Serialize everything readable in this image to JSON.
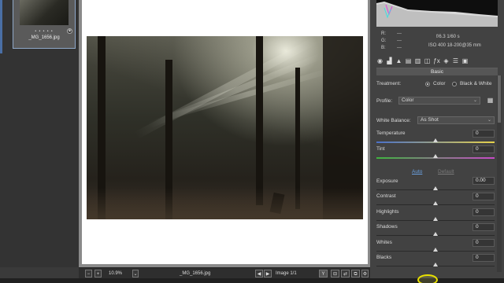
{
  "filmstrip": {
    "thumbnail_name": "_MG_1656.jpg",
    "rating_dots": "• • • • •"
  },
  "statusbar": {
    "zoom": "10.9%",
    "filename": "_MG_1656.jpg",
    "image_counter": "Image 1/1",
    "before_after_label": "Y"
  },
  "info": {
    "r_label": "R:",
    "g_label": "G:",
    "b_label": "B:",
    "r_value": "---",
    "g_value": "---",
    "b_value": "---",
    "aperture_shutter": "f/6.3   1/60 s",
    "iso_lens": "ISO 400   18-200@35 mm"
  },
  "panel": {
    "title": "Basic",
    "treatment_label": "Treatment:",
    "treatment_color": "Color",
    "treatment_bw": "Black & White",
    "treatment_selected": "Color",
    "profile_label": "Profile:",
    "profile_value": "Color",
    "wb_label": "White Balance:",
    "wb_value": "As Shot",
    "auto_label": "Auto",
    "default_label": "Default"
  },
  "sliders": [
    {
      "label": "Temperature",
      "value": "0",
      "level": 0.5
    },
    {
      "label": "Tint",
      "value": "0",
      "level": 0.5
    },
    {
      "label": "Exposure",
      "value": "0.00",
      "level": 0.5
    },
    {
      "label": "Contrast",
      "value": "0",
      "level": 0.5
    },
    {
      "label": "Highlights",
      "value": "0",
      "level": 0.5
    },
    {
      "label": "Shadows",
      "value": "0",
      "level": 0.5
    },
    {
      "label": "Whites",
      "value": "0",
      "level": 0.5
    },
    {
      "label": "Blacks",
      "value": "0",
      "level": 0.5
    }
  ],
  "colors": {
    "accent": "#4a6fa5",
    "auto_link": "#6aa0e0",
    "default_link": "#7a7a7a",
    "cursor_highlight": "#e8e000"
  },
  "icons": [
    "basic-icon",
    "tone-curve-icon",
    "detail-icon",
    "hsl-icon",
    "split-toning-icon",
    "lens-corrections-icon",
    "effects-icon",
    "camera-calibration-icon",
    "presets-icon",
    "snapshots-icon"
  ]
}
